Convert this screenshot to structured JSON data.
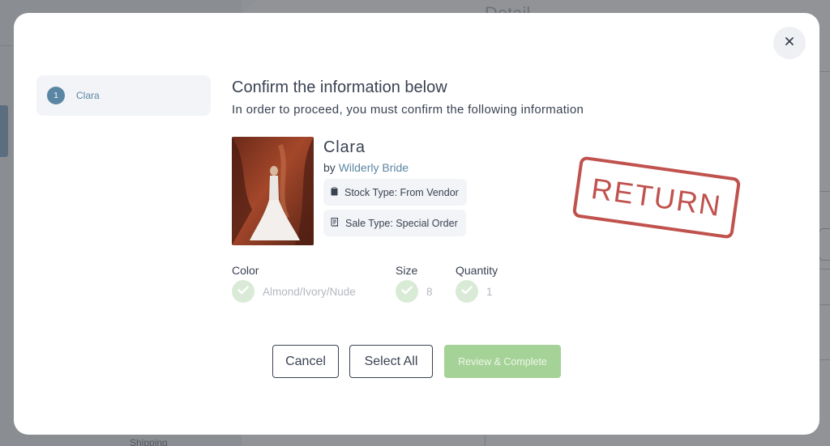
{
  "background": {
    "title": "Detail",
    "partial_text": "Shipping"
  },
  "sidebar": {
    "steps": [
      {
        "number": "1",
        "label": "Clara"
      }
    ]
  },
  "header": {
    "title": "Confirm the information below",
    "subtitle": "In order to proceed, you must confirm the following information"
  },
  "product": {
    "name": "Clara",
    "by_prefix": "by",
    "vendor": "Wilderly Bride",
    "stock_type": "Stock Type: From Vendor",
    "sale_type": "Sale Type: Special Order",
    "stamp": "RETURN"
  },
  "attributes": [
    {
      "label": "Color",
      "value": "Almond/Ivory/Nude"
    },
    {
      "label": "Size",
      "value": "8"
    },
    {
      "label": "Quantity",
      "value": "1"
    }
  ],
  "actions": {
    "cancel": "Cancel",
    "select_all": "Select All",
    "review": "Review & Complete"
  },
  "colors": {
    "accent_blue": "#5b86a3",
    "stamp_red": "#c0524e",
    "success_green": "#a5d296",
    "check_bg": "#d9ebd6"
  },
  "icons": {
    "close": "close-icon",
    "stock": "clipboard-icon",
    "sale": "receipt-icon",
    "check": "check-icon"
  }
}
